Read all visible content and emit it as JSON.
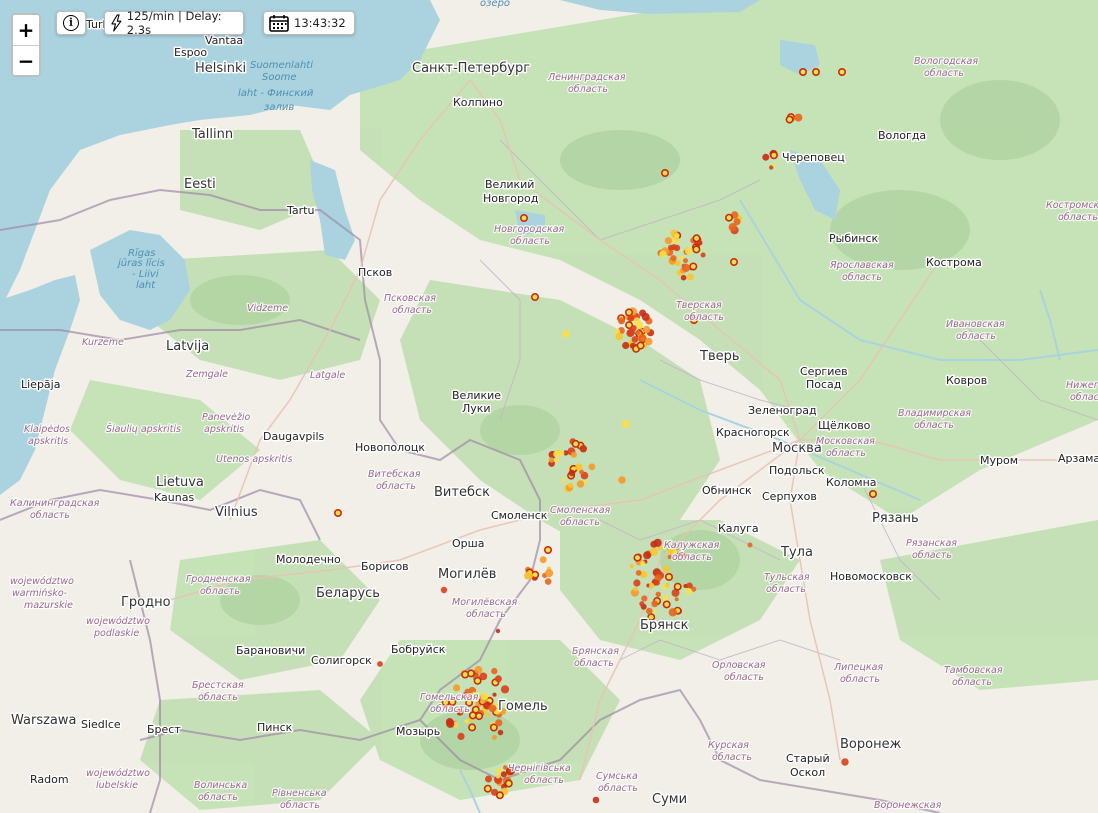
{
  "zoom": {
    "in_label": "+",
    "out_label": "−"
  },
  "controls": {
    "info_icon": "info-icon",
    "rate_icon": "lightning-icon",
    "rate_text": "125/min | Delay: 2.3s",
    "time_icon": "calendar-icon",
    "time_text": "13:43:32"
  },
  "labels": {
    "partial_top_left": "Turk",
    "sea_top": "озеро",
    "cities": {
      "vantaa": "Vantaa",
      "espoo": "Espoo",
      "helsinki": "Helsinki",
      "tallinn": "Tallinn",
      "tartu": "Tartu",
      "pskov": "Псков",
      "spb": "Санкт-Петербург",
      "kolpino": "Колпино",
      "novgorod1": "Великий",
      "novgorod2": "Новгород",
      "vologda": "Вологда",
      "cherepovets": "Череповец",
      "rybinsk": "Рыбинск",
      "kostroma": "Кострома",
      "tver": "Тверь",
      "sergiev1": "Сергиев",
      "sergiev2": "Посад",
      "kovrov": "Ковров",
      "zelenograd": "Зеленоград",
      "shchelkovo": "Щёлково",
      "krasnogorsk": "Красногорск",
      "moskva": "Москва",
      "podolsk": "Подольск",
      "murom": "Муром",
      "arzamas": "Арзамас",
      "obninsk": "Обнинск",
      "serpukhov": "Серпухов",
      "kolomna": "Коломна",
      "ryazan": "Рязань",
      "kaluga": "Калуга",
      "tula": "Тула",
      "novomoskovsk": "Новомосковск",
      "bryansk": "Брянск",
      "vluki1": "Великие",
      "vluki2": "Луки",
      "novopolotsk": "Новополоцк",
      "vitebsk": "Витебск",
      "smolensk": "Смоленск",
      "orsha": "Орша",
      "mogilev": "Могилёв",
      "borisov": "Борисов",
      "molodechno": "Молодечно",
      "belarus": "Беларусь",
      "bobruisk": "Бобруйск",
      "baranovichi": "Барановичи",
      "soligorsk": "Солигорск",
      "grodno": "Гродно",
      "brest": "Брест",
      "pinsk": "Пинск",
      "mozyr": "Мозырь",
      "gomel": "Гомель",
      "warszawa": "Warszawa",
      "siedlce": "Siedlce",
      "radom": "Radom",
      "sumy": "Суми",
      "voronezh": "Воронеж",
      "stary1": "Старый",
      "stary2": "Оскол",
      "vilnius": "Vilnius",
      "kaunas": "Kaunas",
      "lietuva": "Lietuva",
      "daugavpils": "Daugavpils",
      "latvija": "Latvija",
      "liepaja": "Liepāja",
      "eesti": "Eesti"
    },
    "regions": {
      "leningrad1": "Ленинградская",
      "leningrad2": "область",
      "vologda1": "Вологодская",
      "vologda2": "область",
      "kostroma1": "Костромская",
      "kostroma2": "область",
      "yaroslavl1": "Ярославская",
      "yaroslavl2": "область",
      "novgorod1": "Новгородская",
      "novgorod2": "область",
      "tver1": "Тверская",
      "tver2": "область",
      "ivanovo1": "Ивановская",
      "ivanovo2": "область",
      "pskov1": "Псковская",
      "pskov2": "область",
      "vladimir1": "Владимирская",
      "vladimir2": "область",
      "moscow1": "Московская",
      "moscow2": "область",
      "nizhny1": "Нижего",
      "nizhny2": "область",
      "smolensk1": "Смоленская",
      "smolensk2": "область",
      "vitebsk1": "Витебская",
      "vitebsk2": "область",
      "kaluga1": "Калужская",
      "kaluga2": "область",
      "ryazan1": "Рязанская",
      "ryazan2": "область",
      "tula1": "Тульская",
      "tula2": "область",
      "grodno1": "Гродненская",
      "grodno2": "область",
      "mogilev1": "Могилёвская",
      "mogilev2": "область",
      "bryansk1": "Брянская",
      "bryansk2": "область",
      "orel1": "Орловская",
      "orel2": "область",
      "lipetsk1": "Липецкая",
      "lipetsk2": "область",
      "tambov1": "Тамбовская",
      "tambov2": "область",
      "brest1": "Брестская",
      "brest2": "область",
      "gomel1": "Гомельская",
      "gomel2": "область",
      "kursk1": "Курская",
      "kursk2": "область",
      "chernihiv1": "Чернігівська",
      "chernihiv2": "область",
      "sumy1": "Сумська",
      "sumy2": "область",
      "volyn1": "Волинська",
      "volyn2": "область",
      "rivne1": "Рівненська",
      "rivne2": "область",
      "voronezh1": "Воронежская",
      "kaliningrad1": "Калининградская",
      "kaliningrad2": "область",
      "warm1": "województwo",
      "warm2": "warmińsko-",
      "warm3": "mazurskie",
      "podl1": "województwo",
      "podl2": "podlaskie",
      "lub1": "województwo",
      "lub2": "lubelskie",
      "vidzeme": "Vidzeme",
      "kurzeme": "Kurzeme",
      "zemgale": "Zemgale",
      "latgale": "Latgale",
      "panevezys1": "Panevėžio",
      "panevezys2": "apskritis",
      "siauliai": "Šiaulių apskritis",
      "klaipeda1": "Klaipėdos",
      "klaipeda2": "apskritis",
      "utena": "Utenos apskritis"
    },
    "seas": {
      "finn1": "Suomenlahti",
      "finn2": "Soome",
      "finn3": "laht - Финский",
      "finn4": "залив",
      "riga1": "Rīgas",
      "riga2": "jūras līcis",
      "riga3": "- Liivi",
      "riga4": "laht"
    }
  }
}
